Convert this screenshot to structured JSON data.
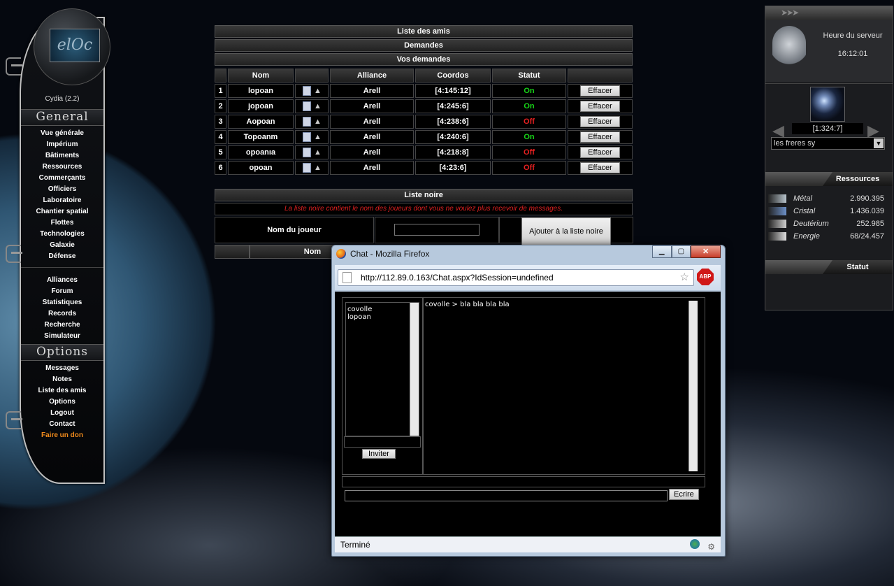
{
  "menu": {
    "player": "Cydia (2.2)",
    "general_title": "General",
    "general_items": [
      "Vue générale",
      "Impérium",
      "Bâtiments",
      "Ressources",
      "Commerçants",
      "Officiers",
      "Laboratoire",
      "Chantier spatial",
      "Flottes",
      "Technologies",
      "Galaxie",
      "Défense"
    ],
    "community_items": [
      "Alliances",
      "Forum",
      "Statistiques",
      "Records",
      "Recherche",
      "Simulateur"
    ],
    "options_title": "Options",
    "options_items": [
      "Messages",
      "Notes",
      "Liste des amis",
      "Options",
      "Logout",
      "Contact"
    ],
    "donate": "Faire un don",
    "logo_text": "elOc"
  },
  "friends": {
    "title": "Liste des amis",
    "requests": "Demandes",
    "your_requests": "Vos demandes",
    "columns": [
      "Nom",
      "",
      "Alliance",
      "Coordos",
      "Statut",
      ""
    ],
    "delete_label": "Effacer",
    "rows": [
      {
        "num": "1",
        "name": "lopoan",
        "alliance": "Arell",
        "coords": "[4:145:12]",
        "status": "On"
      },
      {
        "num": "2",
        "name": "jopoan",
        "alliance": "Arell",
        "coords": "[4:245:6]",
        "status": "On"
      },
      {
        "num": "3",
        "name": "Aopoan",
        "alliance": "Arell",
        "coords": "[4:238:6]",
        "status": "Off"
      },
      {
        "num": "4",
        "name": "Topoanm",
        "alliance": "Arell",
        "coords": "[4:240:6]",
        "status": "On"
      },
      {
        "num": "5",
        "name": "opoanıa",
        "alliance": "Arell",
        "coords": "[4:218:8]",
        "status": "Off"
      },
      {
        "num": "6",
        "name": "opoan",
        "alliance": "Arell",
        "coords": "[4:23:6]",
        "status": "Off"
      }
    ]
  },
  "blacklist": {
    "title": "Liste noire",
    "info": "La liste noire contient le nom des joueurs dont vous ne voulez plus recevoir de messages.",
    "player_label": "Nom du joueur",
    "player_value": "",
    "add_button": "Ajouter à la liste noire",
    "col_name": "Nom"
  },
  "right": {
    "server_time_label": "Heure du serveur",
    "server_time": "16:12:01",
    "planet_coords": "[1:324:7]",
    "planet_name": "les freres sy",
    "resources_title": "Ressources",
    "resources": [
      {
        "name": "Métal",
        "value": "2.990.395",
        "color": "#b8c4cc"
      },
      {
        "name": "Cristal",
        "value": "1.436.039",
        "color": "#6c90c8"
      },
      {
        "name": "Deutérium",
        "value": "252.985",
        "color": "#d0d0d0"
      },
      {
        "name": "Energie",
        "value": "68/24.457",
        "color": "#e0e0e0"
      }
    ],
    "status_title": "Statut"
  },
  "firefox": {
    "title": "Chat - Mozilla Firefox",
    "url": "http://112.89.0.163/Chat.aspx?IdSession=undefined",
    "users": [
      "covolle",
      "lopoan"
    ],
    "invite_label": "Inviter",
    "message": "covolle > bla bla bla bla",
    "input_value": "",
    "write_label": "Ecrire",
    "status": "Terminé",
    "abp": "ABP"
  }
}
